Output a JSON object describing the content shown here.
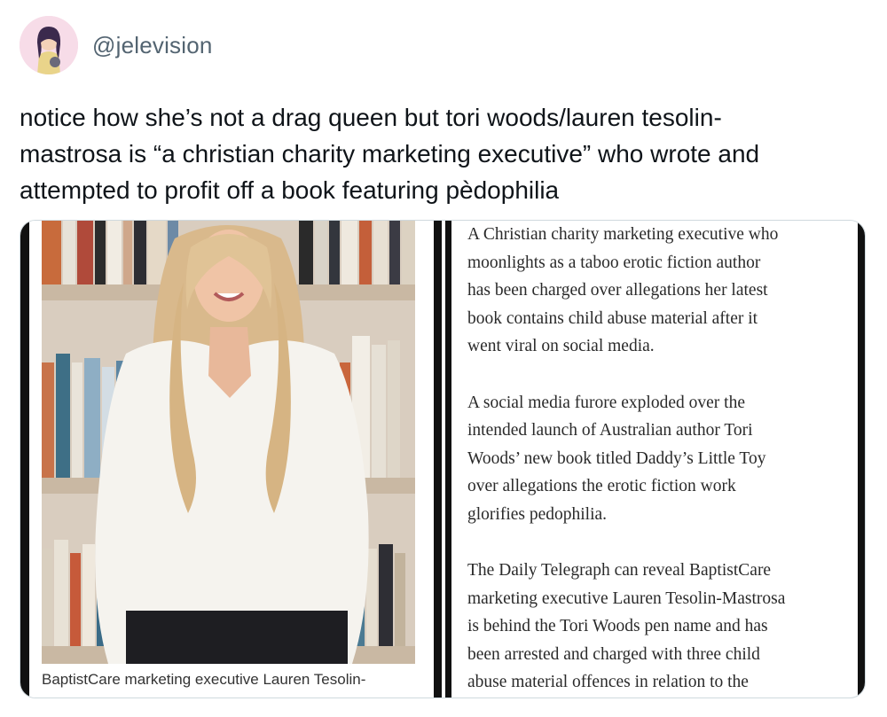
{
  "tweet": {
    "handle": "@jelevision",
    "text": "notice how she’s not a drag queen but tori woods/lauren tesolin-\nmastrosa is “a christian charity marketing executive” who wrote and\nattempted to profit off a book featuring pèdophilia"
  },
  "media": {
    "caption": "BaptistCare marketing executive Lauren Tesolin-",
    "article_paragraphs": [
      "A Christian charity marketing executive who\nmoonlights as a taboo erotic fiction author\nhas been charged over allegations her latest\nbook contains child abuse material after it\nwent viral on social media.",
      "A social media furore exploded over the\nintended launch of Australian author Tori\nWoods’ new book titled Daddy’s Little Toy\nover allegations the erotic fiction work\nglorifies pedophilia.",
      "The Daily Telegraph can reveal BaptistCare\nmarketing executive Lauren Tesolin-Mastrosa\nis behind the Tori Woods pen name and has\nbeen arrested and charged with three child\nabuse material offences in relation to the"
    ]
  }
}
